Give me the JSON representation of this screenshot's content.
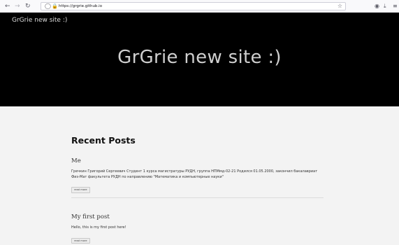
{
  "browser": {
    "url": "https://grgrie.github.io",
    "icons": [
      "back-icon",
      "forward-icon",
      "reload-icon",
      "shield-icon",
      "lock-icon",
      "bookmark-star-icon",
      "pocket-icon",
      "download-icon",
      "menu-icon"
    ]
  },
  "site": {
    "brand": "GrGrie new site :)",
    "hero_title": "GrGrie new site :)",
    "colors": {
      "header_bg": "#000000",
      "page_bg": "#f3f3f3"
    }
  },
  "main": {
    "section_title": "Recent Posts",
    "posts": [
      {
        "title": "Me",
        "excerpt": "Гречкин Григорий Сергеевич Студент 1 курса магистратуры РУДН, группа НПМмд-02-21 Родился 01.05.2000, закончил бакалавриат Физ-Мат факультета РУДН по направлению \"Математика и компьютерные науки\"",
        "read_more": "read more"
      },
      {
        "title": "My first post",
        "excerpt": "Hello, this is my first post here!",
        "read_more": "read more"
      }
    ]
  }
}
